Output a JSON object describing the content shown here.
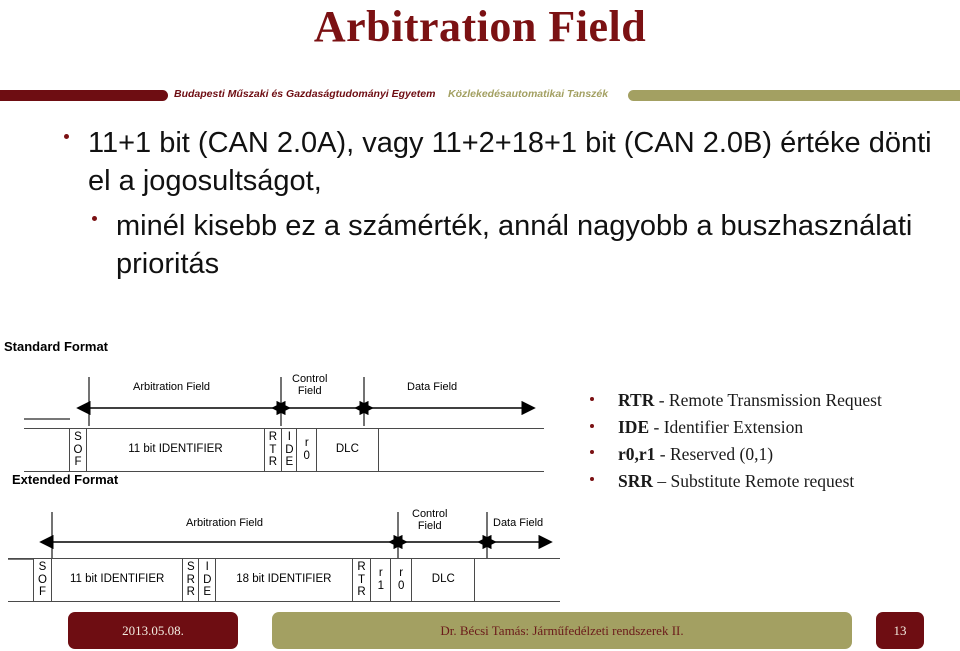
{
  "slide": {
    "title": "Arbitration Field"
  },
  "banner": {
    "university": "Budapesti Műszaki és Gazdaságtudományi Egyetem",
    "department": "Közlekedésautomatikai Tanszék",
    "bar_left_color": "#6e0d12",
    "bar_right_color": "#a3a062"
  },
  "body": {
    "bullets": [
      "11+1 bit (CAN 2.0A), vagy 11+2+18+1 bit (CAN 2.0B) értéke dönti el a jogosultságot,",
      "minél kisebb ez a számérték, annál nagyobb a buszhasználati prioritás"
    ]
  },
  "diagram": {
    "standard": {
      "label": "Standard Format",
      "field_labels": [
        "Arbitration Field",
        "Control\nField",
        "Data Field"
      ],
      "arbitration_label": "Arbitration Field",
      "control_label_line1": "Control",
      "control_label_line2": "Field",
      "data_label": "Data Field",
      "cells": [
        {
          "text": "S\nO\nF",
          "stacked": true
        },
        {
          "text": "11 bit IDENTIFIER",
          "stacked": false
        },
        {
          "text": "R\nT\nR",
          "stacked": true
        },
        {
          "text": "I\nD\nE",
          "stacked": true
        },
        {
          "text": "r\n0",
          "stacked": true
        },
        {
          "text": "DLC",
          "stacked": false
        },
        {
          "text": "",
          "stacked": false
        }
      ]
    },
    "extended": {
      "label": "Extended Format",
      "arbitration_label": "Arbitration Field",
      "control_label_line1": "Control",
      "control_label_line2": "Field",
      "data_label": "Data Field",
      "cells": [
        {
          "text": "S\nO\nF",
          "stacked": true
        },
        {
          "text": "11 bit IDENTIFIER",
          "stacked": false
        },
        {
          "text": "S\nR\nR",
          "stacked": true
        },
        {
          "text": "I\nD\nE",
          "stacked": true
        },
        {
          "text": "18 bit IDENTIFIER",
          "stacked": false
        },
        {
          "text": "R\nT\nR",
          "stacked": true
        },
        {
          "text": "r\n1",
          "stacked": true
        },
        {
          "text": "r\n0",
          "stacked": true
        },
        {
          "text": "DLC",
          "stacked": false
        },
        {
          "text": "",
          "stacked": false
        }
      ]
    }
  },
  "glossary": {
    "items": [
      {
        "term": "RTR",
        "sep": " - ",
        "definition": "Remote Transmission Request"
      },
      {
        "term": "IDE",
        "sep": " - ",
        "definition": "Identifier Extension"
      },
      {
        "term": "r0,r1",
        "sep": " - ",
        "definition": "Reserved (0,1)"
      },
      {
        "term": "SRR",
        "sep": " – ",
        "definition": "Substitute Remote request"
      }
    ]
  },
  "footer": {
    "date": "2013.05.08.",
    "title": "Dr. Bécsi Tamás: Járműfedélzeti rendszerek II.",
    "page": "13"
  }
}
